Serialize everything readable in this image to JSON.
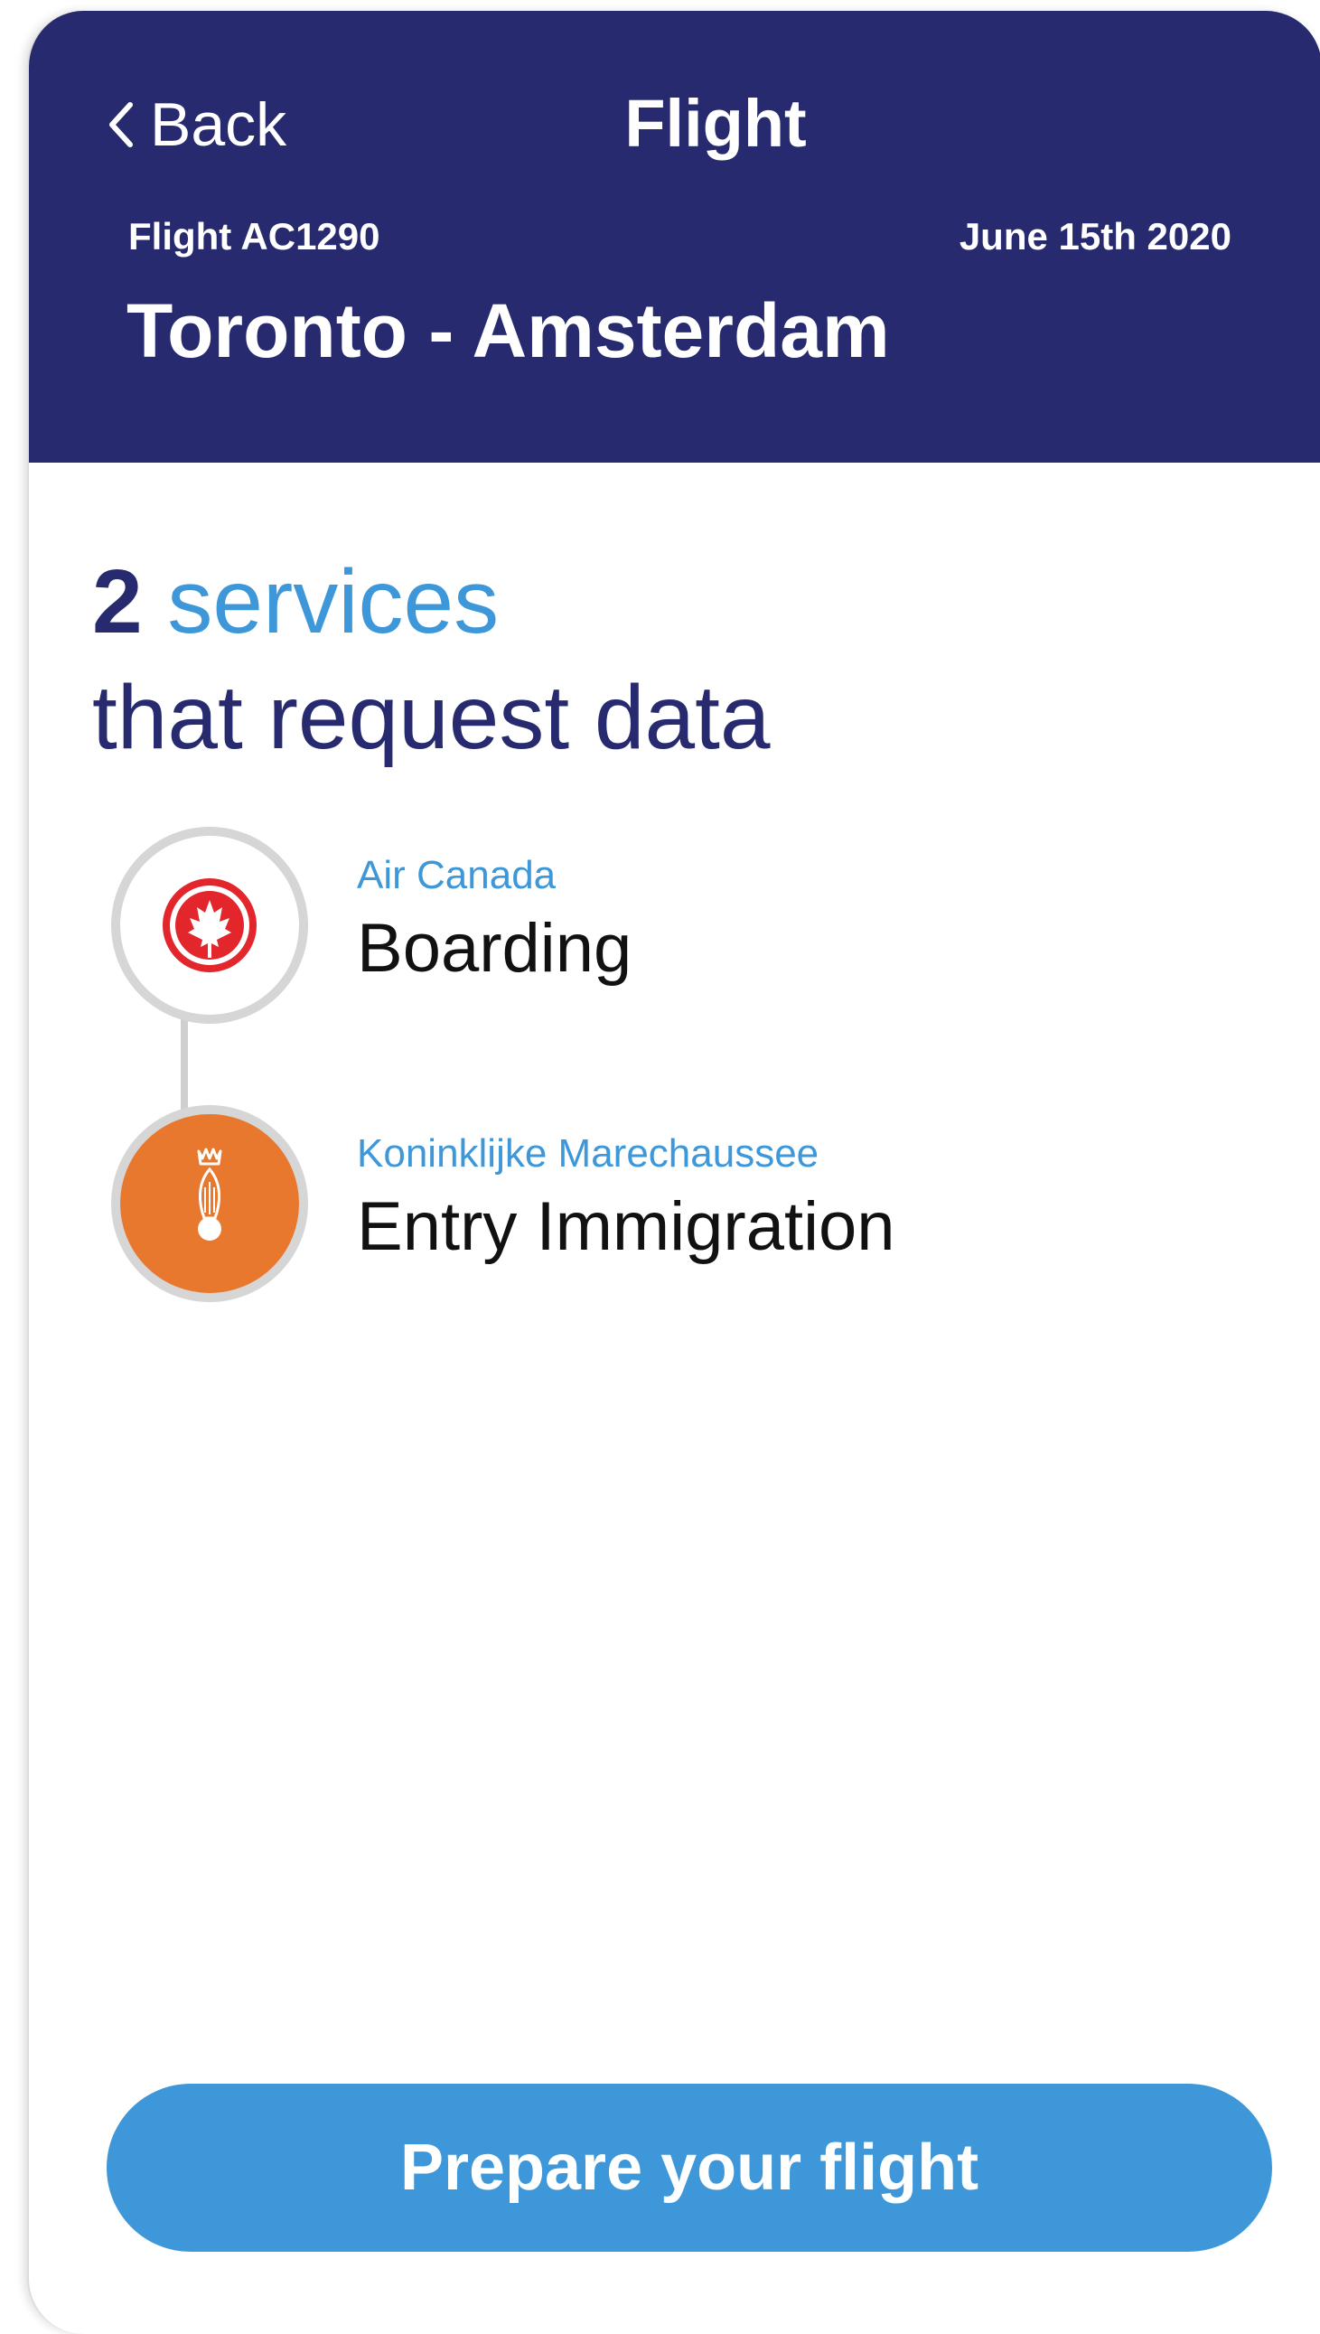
{
  "header": {
    "back_label": "Back",
    "title": "Flight",
    "flight_number": "Flight AC1290",
    "date": "June 15th 2020",
    "route": "Toronto - Amsterdam"
  },
  "headline": {
    "count": "2",
    "accent": "services",
    "rest": "that request data"
  },
  "services": [
    {
      "provider": "Air Canada",
      "name": "Boarding",
      "icon": "maple-leaf-icon",
      "icon_color": "#e3262c"
    },
    {
      "provider": "Koninklijke Marechaussee",
      "name": "Entry Immigration",
      "icon": "crown-grenade-icon",
      "icon_color": "#e8782e"
    }
  ],
  "cta": {
    "label": "Prepare your flight"
  },
  "colors": {
    "header_bg": "#272a6e",
    "accent": "#3e97d8",
    "button": "#3e97d8"
  }
}
